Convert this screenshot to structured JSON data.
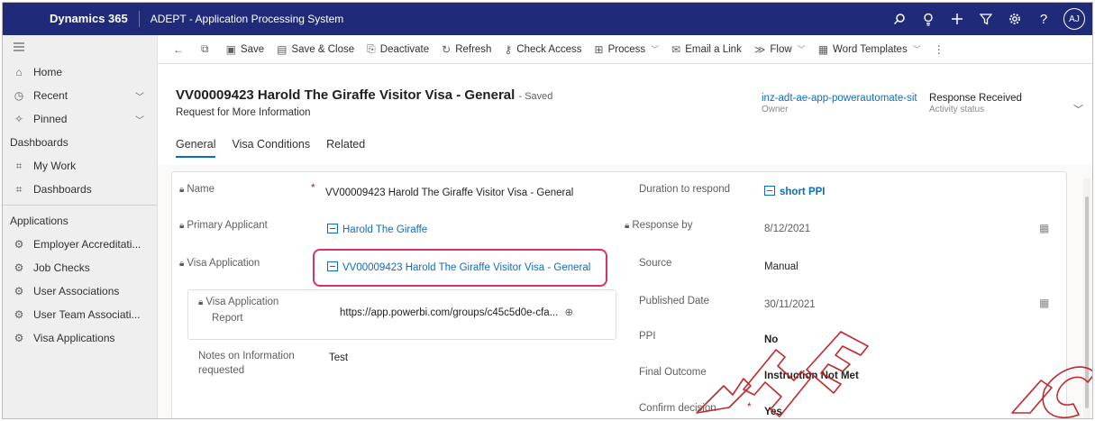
{
  "topbar": {
    "app_name": "Dynamics 365",
    "system_name": "ADEPT - Application Processing System",
    "avatar_initials": "AJ"
  },
  "sidebar": {
    "items_top": [
      {
        "label": "Home",
        "icon": "home-icon"
      },
      {
        "label": "Recent",
        "icon": "clock-icon",
        "chevron": true
      },
      {
        "label": "Pinned",
        "icon": "pin-icon",
        "chevron": true
      }
    ],
    "dashboards_header": "Dashboards",
    "dashboards": [
      {
        "label": "My Work"
      },
      {
        "label": "Dashboards"
      }
    ],
    "applications_header": "Applications",
    "applications": [
      {
        "label": "Employer Accreditati..."
      },
      {
        "label": "Job Checks"
      },
      {
        "label": "User Associations"
      },
      {
        "label": "User Team Associati..."
      },
      {
        "label": "Visa Applications"
      }
    ]
  },
  "commandbar": {
    "save": "Save",
    "save_close": "Save & Close",
    "deactivate": "Deactivate",
    "refresh": "Refresh",
    "check_access": "Check Access",
    "process": "Process",
    "email_link": "Email a Link",
    "flow": "Flow",
    "word_templates": "Word Templates"
  },
  "header": {
    "title": "VV00009423 Harold The Giraffe Visitor Visa - General",
    "saved_status": "- Saved",
    "subtitle": "Request for More Information",
    "owner_value": "inz-adt-ae-app-powerautomate-sit",
    "owner_label": "Owner",
    "status_value": "Response Received",
    "status_label": "Activity status"
  },
  "tabs": [
    "General",
    "Visa Conditions",
    "Related"
  ],
  "form": {
    "left": {
      "name_label": "Name",
      "name_value": "VV00009423 Harold The Giraffe Visitor Visa - General",
      "primary_applicant_label": "Primary Applicant",
      "primary_applicant_value": "Harold The Giraffe",
      "visa_application_label": "Visa Application",
      "visa_application_value": "VV00009423 Harold The Giraffe Visitor Visa - General",
      "report_label_1": "Visa Application",
      "report_label_2": "Report",
      "report_value": "https://app.powerbi.com/groups/c45c5d0e-cfa...",
      "notes_label_1": "Notes on Information",
      "notes_label_2": "requested",
      "notes_value": "Test"
    },
    "right": {
      "duration_label": "Duration to respond",
      "duration_value": "short PPI",
      "response_by_label": "Response by",
      "response_by_value": "8/12/2021",
      "source_label": "Source",
      "source_value": "Manual",
      "published_label": "Published Date",
      "published_value": "30/11/2021",
      "ppi_label": "PPI",
      "ppi_value": "No",
      "final_outcome_label": "Final Outcome",
      "final_outcome_value": "Instruction Not Met",
      "confirm_label": "Confirm decision",
      "confirm_value": "Yes"
    }
  },
  "colors": {
    "topbar_bg": "#1f2a78",
    "link": "#0f6cbd",
    "highlight": "#d6336c"
  }
}
